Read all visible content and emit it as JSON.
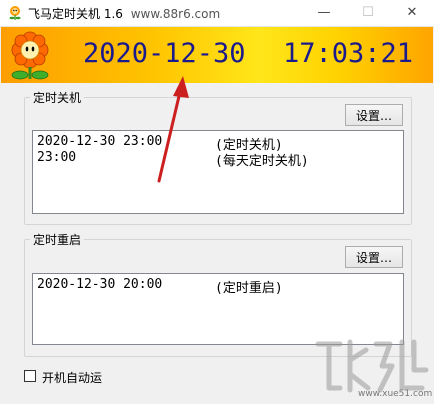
{
  "window": {
    "title": "飞马定时关机 1.6",
    "subtitle": "www.88r6.com",
    "controls": {
      "minimize": "—",
      "maximize": "☐",
      "close": "✕"
    }
  },
  "banner": {
    "date": "2020-12-30",
    "time": "17:03:21"
  },
  "shutdown": {
    "label": "定时关机",
    "button": "设置…",
    "rows": [
      {
        "when": "2020-12-30 23:00",
        "kind": "(定时关机)"
      },
      {
        "when": "23:00",
        "kind": "(每天定时关机)"
      }
    ]
  },
  "restart": {
    "label": "定时重启",
    "button": "设置…",
    "rows": [
      {
        "when": "2020-12-30 20:00",
        "kind": "(定时重启)"
      }
    ]
  },
  "autostart": {
    "label": "开机自动运",
    "checked": false
  },
  "watermark": {
    "domain": "www.xue51.com"
  },
  "colors": {
    "clock_text": "#1a1a8c",
    "annotation_arrow": "#cc1f1f",
    "banner_start": "#ff9d00",
    "banner_mid": "#ffe61a"
  },
  "icons": {
    "app": "flower-icon",
    "banner": "flower-icon"
  }
}
